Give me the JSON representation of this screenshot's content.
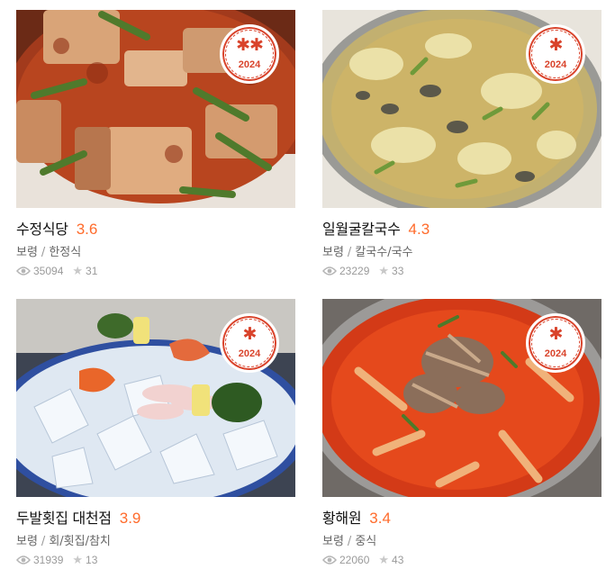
{
  "restaurants": [
    {
      "name": "수정식당",
      "score": "3.6",
      "region": "보령",
      "category": "한정식",
      "views": "35094",
      "reviews": "31",
      "badge": {
        "stars": "✱✱",
        "year": "2024"
      }
    },
    {
      "name": "일월굴칼국수",
      "score": "4.3",
      "region": "보령",
      "category": "칼국수/국수",
      "views": "23229",
      "reviews": "33",
      "badge": {
        "stars": "✱",
        "year": "2024"
      }
    },
    {
      "name": "두발횟집 대천점",
      "score": "3.9",
      "region": "보령",
      "category": "회/횟집/참치",
      "views": "31939",
      "reviews": "13",
      "badge": {
        "stars": "✱",
        "year": "2024"
      }
    },
    {
      "name": "황해원",
      "score": "3.4",
      "region": "보령",
      "category": "중식",
      "views": "22060",
      "reviews": "43",
      "badge": {
        "stars": "✱",
        "year": "2024"
      }
    }
  ],
  "separator": "/",
  "icons": {
    "views": "eye-icon",
    "reviews": "star-icon"
  },
  "colors": {
    "score": "#ff6b2b",
    "badge": "#d9432b"
  }
}
